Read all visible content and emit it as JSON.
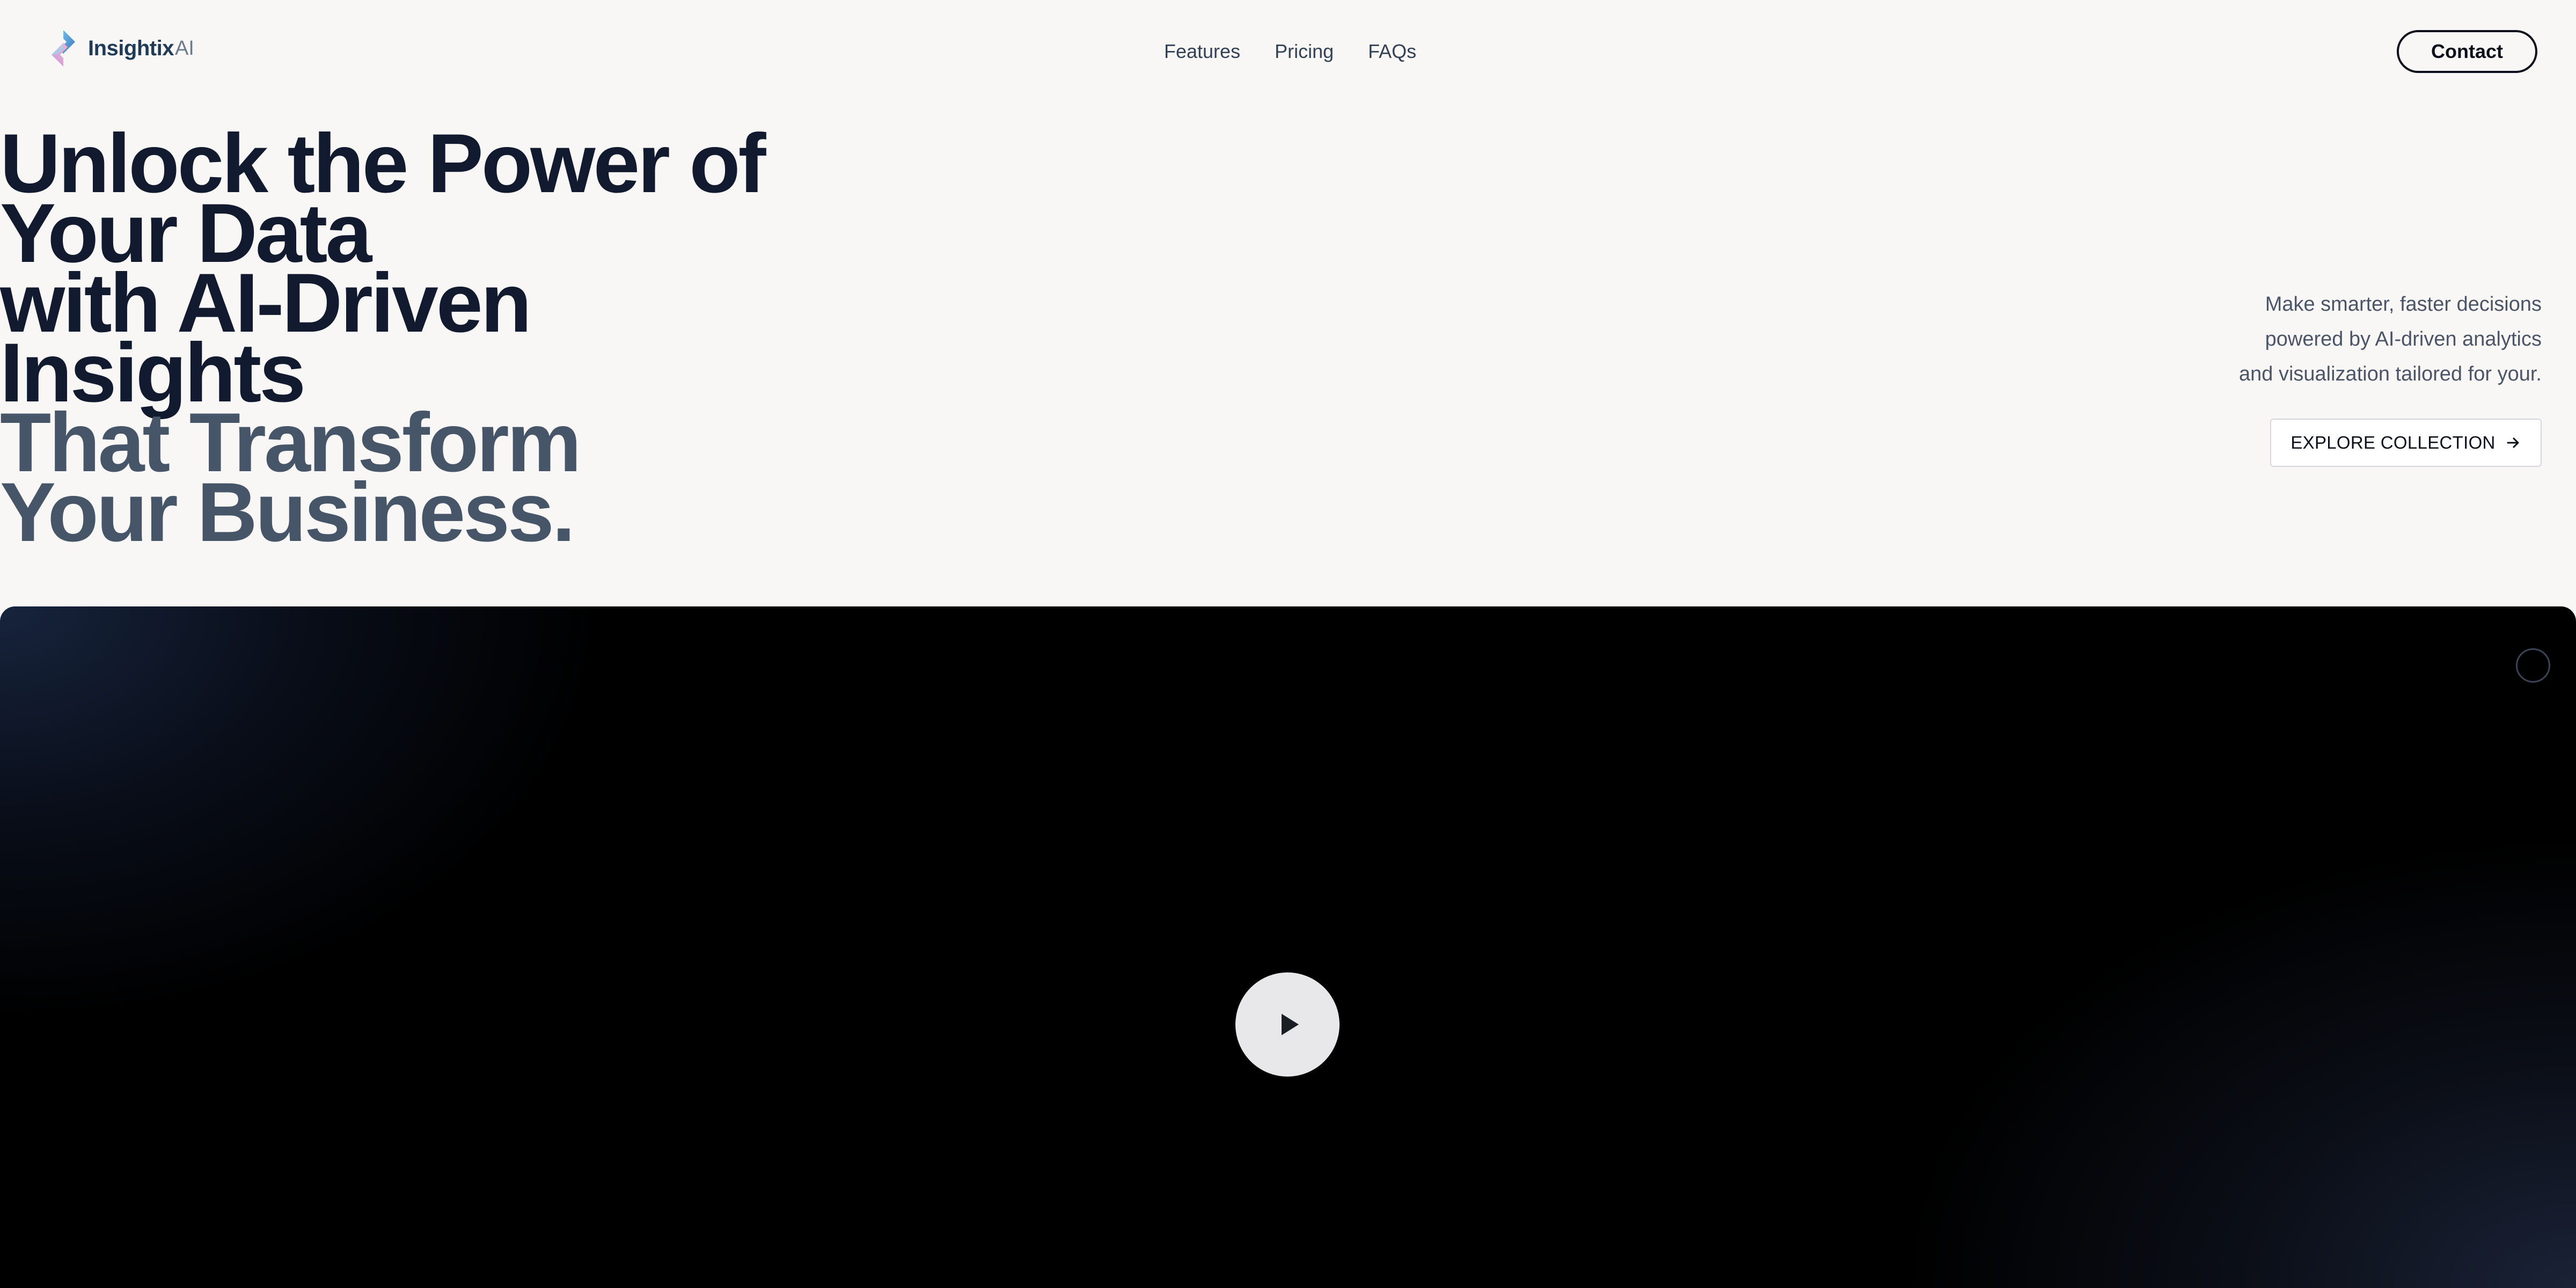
{
  "brand": {
    "name": "Insightix",
    "suffix": "AI"
  },
  "nav": {
    "links": [
      "Features",
      "Pricing",
      "FAQs"
    ],
    "contact_label": "Contact"
  },
  "hero": {
    "heading_lines": [
      "Unlock the Power of",
      "Your Data",
      "with AI-Driven",
      "Insights"
    ],
    "heading_muted_lines": [
      "That Transform",
      "Your Business."
    ],
    "subtitle_lines": [
      "Make smarter, faster decisions",
      "powered by AI-driven analytics",
      "and visualization tailored for your."
    ],
    "cta_label": "EXPLORE COLLECTION"
  },
  "video": {
    "play_icon": "play-icon",
    "corner_icon": "circle-icon"
  },
  "colors": {
    "page_bg": "#f8f7f5",
    "heading": "#111a2e",
    "heading_muted": "#475569",
    "video_bg": "#000000"
  }
}
